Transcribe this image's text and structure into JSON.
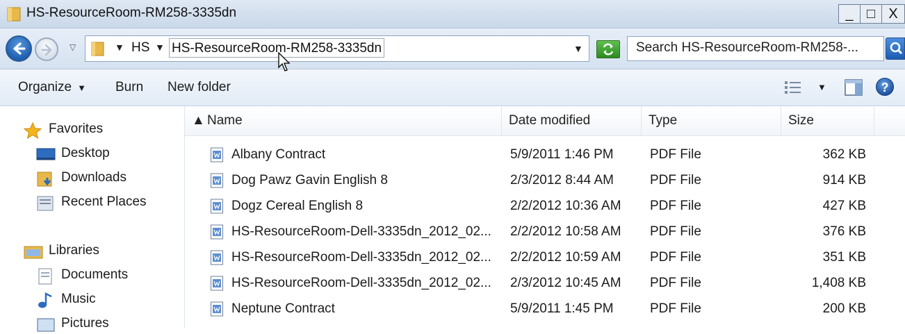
{
  "window": {
    "title": "HS-ResourceRoom-RM258-3335dn",
    "controls": {
      "minimize": "_",
      "maximize": "□",
      "close": "X"
    }
  },
  "address": {
    "crumbs": [
      "HS",
      "HS-ResourceRoom-RM258-3335dn"
    ],
    "search_placeholder": "Search HS-ResourceRoom-RM258-..."
  },
  "toolbar": {
    "organize": "Organize",
    "burn": "Burn",
    "new_folder": "New folder"
  },
  "nav": {
    "favorites": "Favorites",
    "favorites_items": [
      "Desktop",
      "Downloads",
      "Recent Places"
    ],
    "libraries": "Libraries",
    "libraries_items": [
      "Documents",
      "Music",
      "Pictures"
    ]
  },
  "columns": {
    "name": "Name",
    "date": "Date modified",
    "type": "Type",
    "size": "Size"
  },
  "files": [
    {
      "name": "Albany Contract",
      "date": "5/9/2011 1:46 PM",
      "type": "PDF File",
      "size": "362 KB"
    },
    {
      "name": "Dog Pawz Gavin English 8",
      "date": "2/3/2012 8:44 AM",
      "type": "PDF File",
      "size": "914 KB"
    },
    {
      "name": "Dogz Cereal English 8",
      "date": "2/2/2012 10:36 AM",
      "type": "PDF File",
      "size": "427 KB"
    },
    {
      "name": "HS-ResourceRoom-Dell-3335dn_2012_02...",
      "date": "2/2/2012 10:58 AM",
      "type": "PDF File",
      "size": "376 KB"
    },
    {
      "name": "HS-ResourceRoom-Dell-3335dn_2012_02...",
      "date": "2/2/2012 10:59 AM",
      "type": "PDF File",
      "size": "351 KB"
    },
    {
      "name": "HS-ResourceRoom-Dell-3335dn_2012_02...",
      "date": "2/3/2012 10:45 AM",
      "type": "PDF File",
      "size": "1,408 KB"
    },
    {
      "name": "Neptune Contract",
      "date": "5/9/2011 1:45 PM",
      "type": "PDF File",
      "size": "200 KB"
    }
  ],
  "icons": {
    "title": "folder-icon",
    "back": "back-arrow-icon",
    "forward": "forward-arrow-icon",
    "refresh": "refresh-icon",
    "search": "search-icon",
    "views": "views-icon",
    "preview_pane": "preview-pane-icon",
    "help": "help-icon",
    "file": "document-icon"
  }
}
